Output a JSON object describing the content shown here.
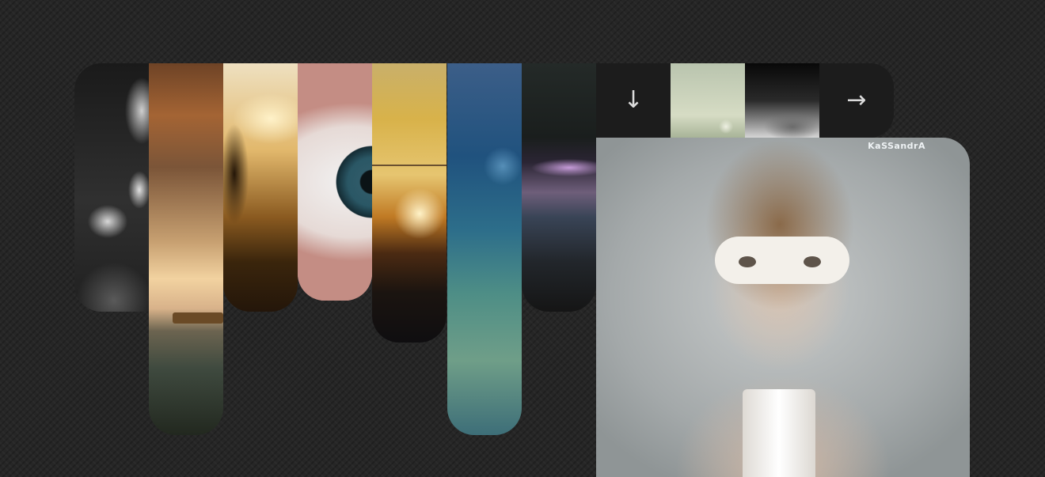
{
  "gallery": {
    "strips": [
      {
        "name": "tiger-portrait"
      },
      {
        "name": "sunset-sea"
      },
      {
        "name": "wheat-silhouette"
      },
      {
        "name": "eye-closeup"
      },
      {
        "name": "sunset-fence"
      },
      {
        "name": "grass-dew"
      },
      {
        "name": "purple-droplet"
      }
    ],
    "nav": {
      "down_icon": "↓",
      "next_icon": "→"
    },
    "featured": {
      "watermark": "KaSSandrA"
    }
  },
  "colors": {
    "background": "#262626",
    "tile": "#1c1c1c"
  }
}
